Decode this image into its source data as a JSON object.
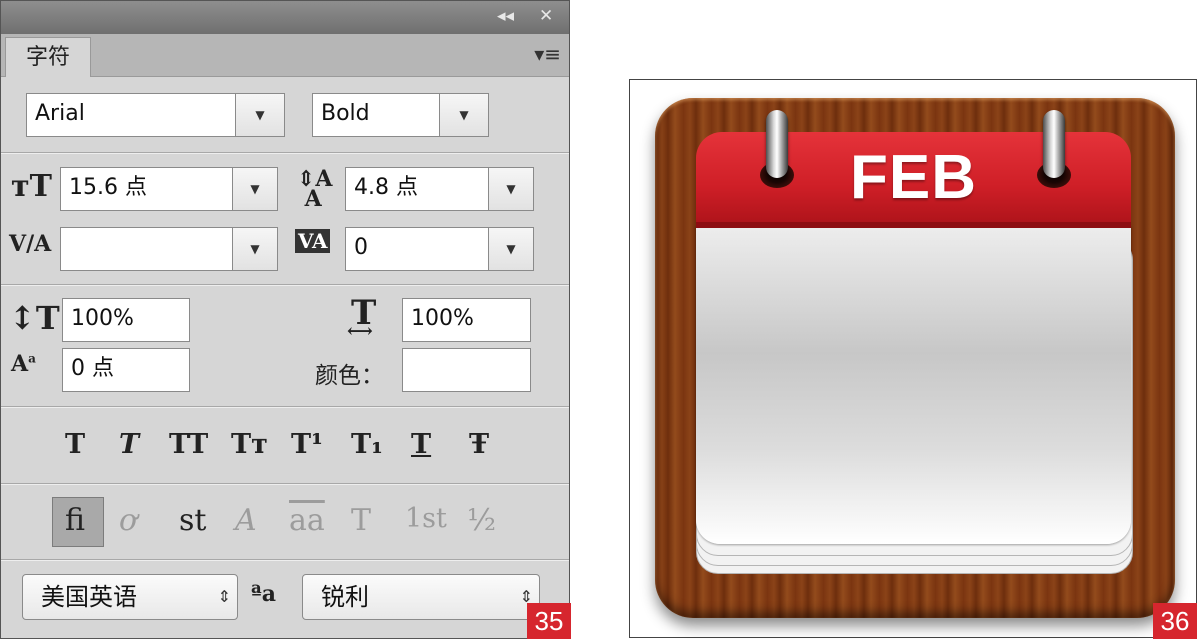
{
  "panel": {
    "tab_label": "字符",
    "collapse_glyph": "◂◂",
    "close_glyph": "✕",
    "menu_glyph": "▾≡",
    "font_family": "Arial",
    "font_style": "Bold",
    "font_size": "15.6 点",
    "leading": "4.8 点",
    "kerning": "",
    "tracking": "0",
    "vertical_scale": "100%",
    "horizontal_scale": "100%",
    "baseline_shift": "0 点",
    "color_label": "颜色：",
    "language": "美国英语",
    "antialias_glyph": "ªa",
    "antialias": "锐利",
    "dropdown_glyph": "▼",
    "select_glyph": "⇕",
    "style_buttons": [
      "T",
      "T",
      "TT",
      "Tт",
      "T¹",
      "T₁",
      "T",
      "Ŧ"
    ],
    "opentype_buttons": [
      "ﬁ",
      "ơ",
      "st",
      "A",
      "aa",
      "T",
      "1st",
      "½"
    ]
  },
  "calendar": {
    "month": "FEB"
  },
  "badges": {
    "left": "35",
    "right": "36"
  },
  "colors": {
    "panel_bg": "#d6d6d6",
    "badge_red": "#d6262e",
    "calendar_red": "#cf1f27",
    "wood": "#7a3410"
  }
}
